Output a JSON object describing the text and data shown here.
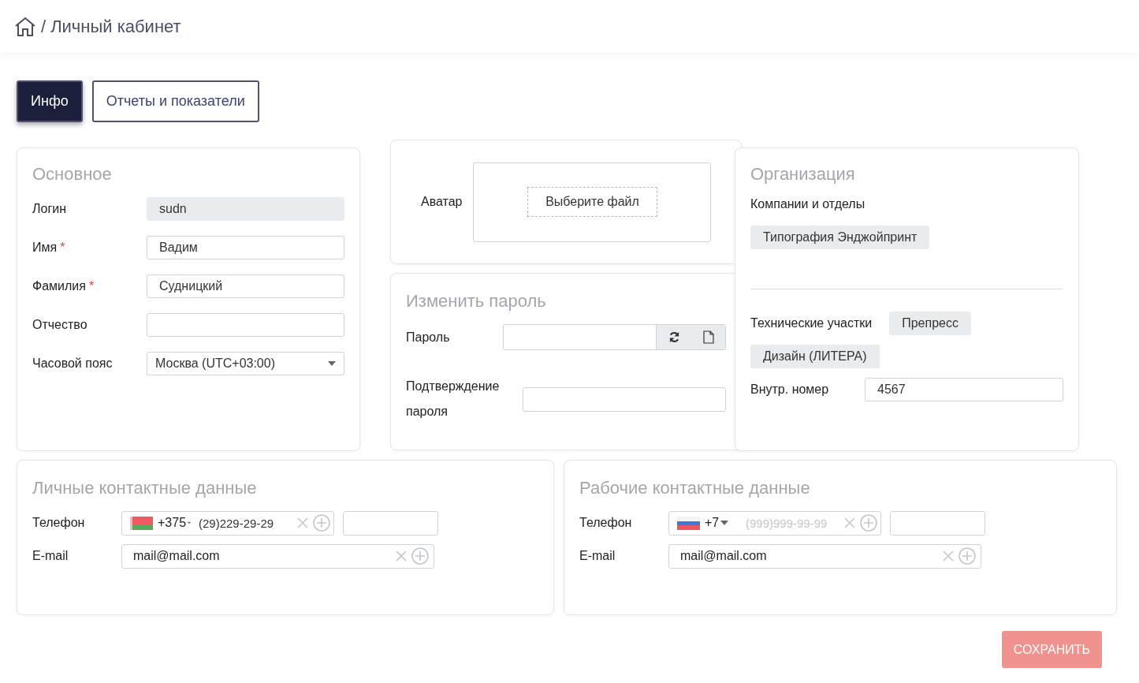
{
  "breadcrumb": {
    "separator": "/",
    "title": "Личный кабинет"
  },
  "tabs": [
    {
      "label": "Инфо",
      "selected": true
    },
    {
      "label": "Отчеты и показатели",
      "selected": false
    }
  ],
  "required_mark": "*",
  "basic": {
    "title": "Основное",
    "fields": [
      {
        "label": "Логин",
        "value": "sudn",
        "kind": "readonly",
        "required": false
      },
      {
        "label": "Имя",
        "value": "Вадим",
        "kind": "text",
        "required": true
      },
      {
        "label": "Фамилия",
        "value": "Судницкий",
        "kind": "text",
        "required": true
      },
      {
        "label": "Отчество",
        "kind": "text",
        "required": false
      },
      {
        "label": "Часовой пояс",
        "value": "Москва (UTC+03:00)",
        "kind": "select",
        "required": false
      }
    ]
  },
  "avatar": {
    "label": "Аватар",
    "button": "Выберите файл"
  },
  "password": {
    "title": "Изменить пароль",
    "fields": [
      {
        "label": "Пароль",
        "kind": "generate"
      },
      {
        "label": "Подтверждение пароля",
        "kind": "plain"
      }
    ]
  },
  "organization": {
    "title": "Организация",
    "companies_label": "Компании и отделы",
    "companies": [
      "Типография Энджойпринт"
    ],
    "sites_label": "Технические участки",
    "sites": [
      "Препресс",
      "Дизайн (ЛИТЕРА)"
    ],
    "extension_label": "Внутр. номер",
    "extension": "4567"
  },
  "contacts": [
    {
      "title": "Личные контактные данные",
      "phone_label": "Телефон",
      "kind": "by",
      "code": "+375",
      "phone": "(29)229-29-29",
      "email_label": "E-mail",
      "email": "mail@mail.com"
    },
    {
      "title": "Рабочие контактные данные",
      "phone_label": "Телефон",
      "kind": "ru",
      "code": "+7",
      "phone_placeholder": "(999)999-99-99",
      "email_label": "E-mail",
      "email": "mail@mail.com"
    }
  ],
  "save": {
    "label": "СОХРАНИТЬ",
    "disabled": true
  }
}
